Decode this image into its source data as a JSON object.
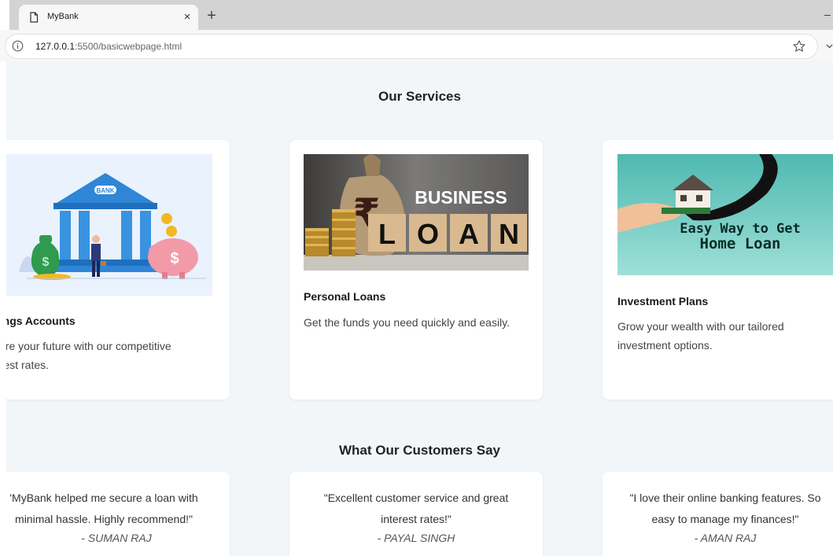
{
  "browser": {
    "tab_title": "MyBank",
    "tab_close": "×",
    "new_tab": "+",
    "url_host": "127.0.0.1",
    "url_path": ":5500/basicwebpage.html",
    "icons": [
      "page-icon",
      "info-icon",
      "star-icon",
      "close-icon",
      "plus-icon"
    ]
  },
  "services": {
    "title": "Our Services",
    "cards": [
      {
        "title": "vings Accounts",
        "text": "cure your future with our competitive\nerest rates.",
        "image": {
          "badge": "BANK"
        }
      },
      {
        "title": "Personal Loans",
        "text": "Get the funds you need quickly and easily.",
        "image": {
          "word_top": "BUSINESS",
          "letters": [
            "L",
            "O",
            "A",
            "N"
          ],
          "symbol": "₹"
        }
      },
      {
        "title": "Investment Plans",
        "text": "Grow your wealth with our tailored investment options.",
        "image": {
          "line1": "Easy Way to Get",
          "line2": "Home Loan"
        }
      }
    ]
  },
  "testimonials": {
    "title": "What Our Customers Say",
    "items": [
      {
        "quote": "'MyBank helped me secure a loan with\nminimal hassle. Highly recommend!\"",
        "author": "- SUMAN RAJ"
      },
      {
        "quote": "\"Excellent customer service and great\ninterest rates!\"",
        "author": "- PAYAL SINGH"
      },
      {
        "quote": "\"I love their online banking features. So\neasy to manage my finances!\"",
        "author": "- AMAN RAJ"
      }
    ]
  },
  "colors": {
    "page_bg": "#f3f6f9",
    "card_bg": "#ffffff",
    "bank_blue": "#2f86d6",
    "home_teal": "#66cbc2"
  }
}
